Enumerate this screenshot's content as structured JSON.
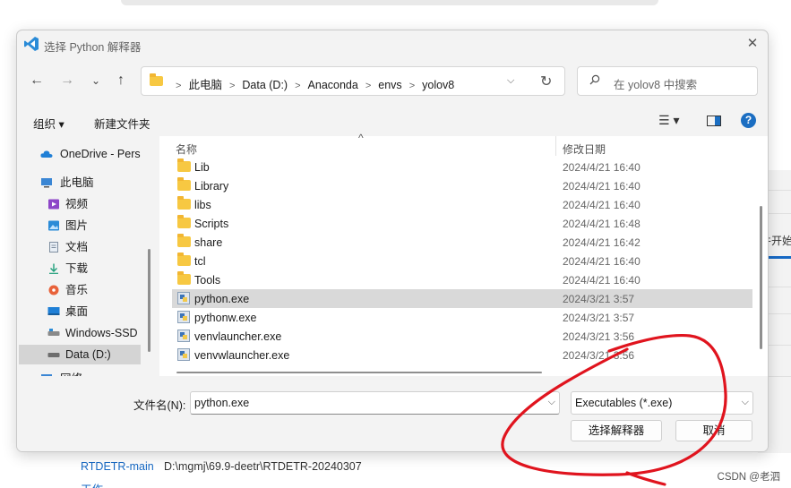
{
  "background": {
    "partial_text": "件开始",
    "bottom_link": "RTDETR-main",
    "bottom_path": "D:\\mgmj\\69.9-deetr\\RTDETR-20240307",
    "bottom_cut": "工作",
    "watermark": "CSDN @老泗"
  },
  "dialog": {
    "title": "选择 Python 解释器",
    "close_glyph": "✕",
    "nav": {
      "back": "←",
      "forward": "→",
      "recent": "⌄",
      "up": "↑"
    },
    "breadcrumbs": [
      "此电脑",
      "Data (D:)",
      "Anaconda",
      "envs",
      "yolov8"
    ],
    "address_dropdown": "⌵",
    "refresh": "↻",
    "search_placeholder": "在 yolov8 中搜索",
    "toolbar": {
      "organize": "组织 ▾",
      "new_folder": "新建文件夹",
      "view": "☰ ▾"
    },
    "help": "?",
    "sidebar": [
      {
        "label": "OneDrive - Pers",
        "icon": "cloud-icon",
        "selected": false
      },
      {
        "label": "此电脑",
        "icon": "computer-icon",
        "selected": false
      },
      {
        "label": "视频",
        "icon": "video-icon",
        "selected": false
      },
      {
        "label": "图片",
        "icon": "pictures-icon",
        "selected": false
      },
      {
        "label": "文档",
        "icon": "documents-icon",
        "selected": false
      },
      {
        "label": "下载",
        "icon": "download-icon",
        "selected": false
      },
      {
        "label": "音乐",
        "icon": "music-icon",
        "selected": false
      },
      {
        "label": "桌面",
        "icon": "desktop-icon",
        "selected": false
      },
      {
        "label": "Windows-SSD",
        "icon": "drive-icon",
        "selected": false
      },
      {
        "label": "Data (D:)",
        "icon": "drive-icon",
        "selected": true
      },
      {
        "label": "网络",
        "icon": "network-icon",
        "selected": false
      }
    ],
    "columns": {
      "name": "名称",
      "sort_indicator": "^",
      "date": "修改日期"
    },
    "files": [
      {
        "name": "Lib",
        "date": "2024/4/21 16:40",
        "type": "folder"
      },
      {
        "name": "Library",
        "date": "2024/4/21 16:40",
        "type": "folder"
      },
      {
        "name": "libs",
        "date": "2024/4/21 16:40",
        "type": "folder"
      },
      {
        "name": "Scripts",
        "date": "2024/4/21 16:48",
        "type": "folder"
      },
      {
        "name": "share",
        "date": "2024/4/21 16:42",
        "type": "folder"
      },
      {
        "name": "tcl",
        "date": "2024/4/21 16:40",
        "type": "folder"
      },
      {
        "name": "Tools",
        "date": "2024/4/21 16:40",
        "type": "folder"
      },
      {
        "name": "python.exe",
        "date": "2024/3/21 3:57",
        "type": "exe",
        "selected": true
      },
      {
        "name": "pythonw.exe",
        "date": "2024/3/21 3:57",
        "type": "exe"
      },
      {
        "name": "venvlauncher.exe",
        "date": "2024/3/21 3:56",
        "type": "exe"
      },
      {
        "name": "venvwlauncher.exe",
        "date": "2024/3/21 3:56",
        "type": "exe"
      }
    ],
    "filename_label": "文件名(N):",
    "filename_value": "python.exe",
    "filetype_value": "Executables (*.exe)",
    "dropdown_glyph": "⌵",
    "open_button": "选择解释器",
    "cancel_button": "取消"
  },
  "colors": {
    "accent": "#1b6ec2",
    "folder": "#f7c842",
    "annotation": "#e0141e"
  }
}
